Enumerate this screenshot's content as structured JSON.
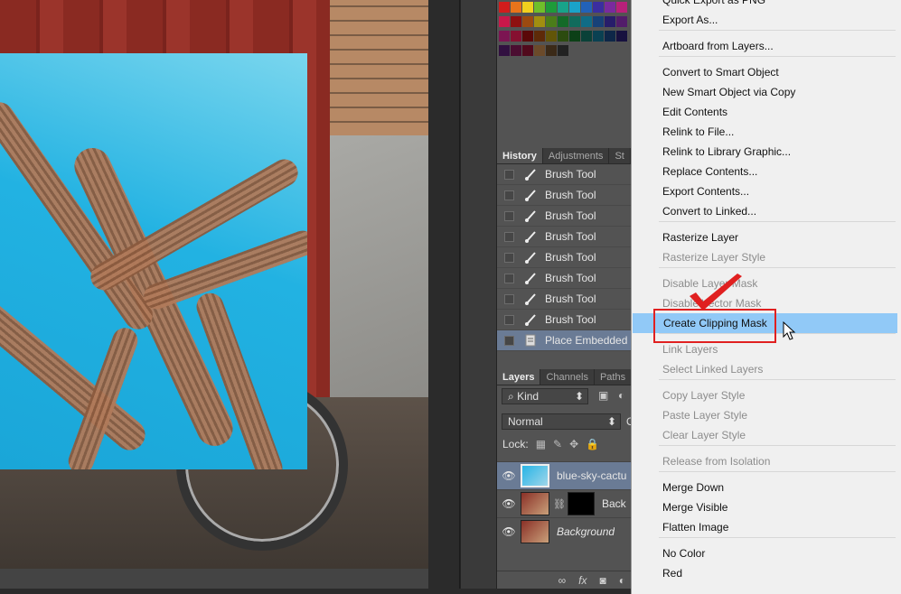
{
  "history": {
    "tabs": [
      "History",
      "Adjustments",
      "St"
    ],
    "items": [
      {
        "label": "Brush Tool",
        "selected": false
      },
      {
        "label": "Brush Tool",
        "selected": false
      },
      {
        "label": "Brush Tool",
        "selected": false
      },
      {
        "label": "Brush Tool",
        "selected": false
      },
      {
        "label": "Brush Tool",
        "selected": false
      },
      {
        "label": "Brush Tool",
        "selected": false
      },
      {
        "label": "Brush Tool",
        "selected": false
      },
      {
        "label": "Brush Tool",
        "selected": false
      },
      {
        "label": "Place Embedded",
        "selected": true
      }
    ]
  },
  "layers": {
    "tabs": [
      "Layers",
      "Channels",
      "Paths"
    ],
    "filter": "Kind",
    "blend_mode": "Normal",
    "lock_label": "Lock:",
    "items": [
      {
        "name": "blue-sky-cactu",
        "selected": true
      },
      {
        "name": "Back",
        "selected": false
      },
      {
        "name": "Background",
        "selected": false
      }
    ]
  },
  "menu": {
    "items": [
      {
        "label": "Quick Export as PNG",
        "disabled": false
      },
      {
        "label": "Export As...",
        "disabled": false
      },
      {
        "label": "Artboard from Layers...",
        "disabled": false
      },
      {
        "label": "Convert to Smart Object",
        "disabled": false
      },
      {
        "label": "New Smart Object via Copy",
        "disabled": false
      },
      {
        "label": "Edit Contents",
        "disabled": false
      },
      {
        "label": "Relink to File...",
        "disabled": false
      },
      {
        "label": "Relink to Library Graphic...",
        "disabled": false
      },
      {
        "label": "Replace Contents...",
        "disabled": false
      },
      {
        "label": "Export Contents...",
        "disabled": false
      },
      {
        "label": "Convert to Linked...",
        "disabled": false
      },
      {
        "label": "Rasterize Layer",
        "disabled": false
      },
      {
        "label": "Rasterize Layer Style",
        "disabled": true
      },
      {
        "label": "Disable Layer Mask",
        "disabled": true
      },
      {
        "label": "Disable Vector Mask",
        "disabled": true
      },
      {
        "label": "Create Clipping Mask",
        "disabled": false,
        "highlighted": true
      },
      {
        "label": "Link Layers",
        "disabled": true
      },
      {
        "label": "Select Linked Layers",
        "disabled": true
      },
      {
        "label": "Copy Layer Style",
        "disabled": true
      },
      {
        "label": "Paste Layer Style",
        "disabled": true
      },
      {
        "label": "Clear Layer Style",
        "disabled": true
      },
      {
        "label": "Release from Isolation",
        "disabled": true
      },
      {
        "label": "Merge Down",
        "disabled": false
      },
      {
        "label": "Merge Visible",
        "disabled": false
      },
      {
        "label": "Flatten Image",
        "disabled": false
      },
      {
        "label": "No Color",
        "disabled": false
      },
      {
        "label": "Red",
        "disabled": false
      }
    ]
  },
  "colors": {
    "highlight": "#91c9f7",
    "annotation": "#e02020",
    "selected_row": "#6a7b95"
  }
}
